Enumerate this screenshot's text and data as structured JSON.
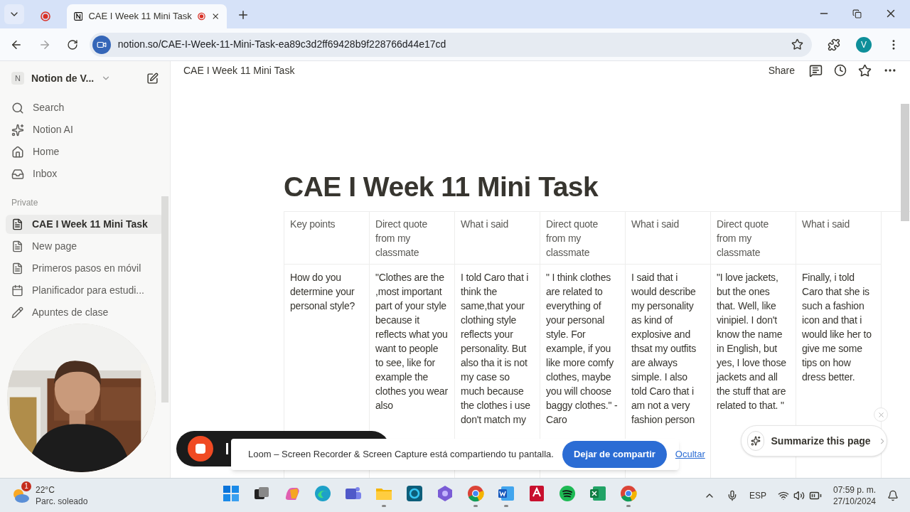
{
  "browser": {
    "tabs": [
      {
        "title": "CAE I Week 11 Mini Task",
        "selected": true
      }
    ],
    "url": "notion.so/CAE-I-Week-11-Mini-Task-ea89c3d2ff69428b9f228766d44e17cd",
    "profile": "V"
  },
  "sidebar": {
    "workspace_icon": "N",
    "workspace": "Notion de V...",
    "nav": [
      {
        "label": "Search"
      },
      {
        "label": "Notion AI"
      },
      {
        "label": "Home"
      },
      {
        "label": "Inbox"
      }
    ],
    "section": "Private",
    "pages": [
      {
        "label": "CAE I Week 11 Mini Task",
        "kind": "doc",
        "selected": true
      },
      {
        "label": "New page",
        "kind": "doc",
        "selected": false
      },
      {
        "label": "Primeros pasos en móvil",
        "kind": "doc",
        "selected": false
      },
      {
        "label": "Planificador para estudi...",
        "kind": "calendar",
        "selected": false
      },
      {
        "label": "Apuntes de clase",
        "kind": "pencil",
        "selected": false
      }
    ]
  },
  "topbar": {
    "breadcrumb": "CAE I Week 11 Mini Task",
    "share": "Share"
  },
  "page": {
    "title": "CAE I Week 11 Mini Task",
    "table": {
      "columns": [
        "Key points",
        "Direct quote from my classmate",
        "What i said",
        "Direct quote from my classmate",
        "What i said",
        "Direct quote from my classmate",
        "What i said"
      ],
      "rows": [
        [
          "How do you determine your personal style?",
          "\"Clothes are the ,most important part of your style because it reflects what you want to people to see, like for example the clothes you wear also",
          "I told Caro that i think the same,that your clothing style reflects your personality. But also tha it is not my case so much because the clothes i use don't match my",
          "\" I think clothes are related to everything of your personal style. For example, if you like more comfy clothes, maybe you will choose baggy clothes.\" - Caro",
          "I  said that i would describe my personality as kind of explosive and thsat my outfits are always simple. I also told Caro that i am not a very fashion person",
          "\"I love jackets, but the ones that. Well, like vinipiel. I don't know the name in English, but yes, I love those jackets and all the stuff that are related to that. \"",
          "Finally, i told Caro that she is such a fashion icon and that i would like her to give me some tips on how dress better."
        ]
      ]
    }
  },
  "summarize": {
    "label": "Summarize this page"
  },
  "loom": {
    "message": "Loom – Screen Recorder & Screen Capture está compartiendo tu pantalla.",
    "stop": "Dejar de compartir",
    "hide": "Ocultar"
  },
  "taskbar": {
    "weather": {
      "temp": "22°C",
      "desc": "Parc. soleado",
      "badge": "1"
    },
    "apps": [
      {
        "running": false
      },
      {
        "running": false
      },
      {
        "running": false
      },
      {
        "running": false
      },
      {
        "running": false
      },
      {
        "running": true
      },
      {
        "running": false
      },
      {
        "running": false
      },
      {
        "running": true
      },
      {
        "running": true
      },
      {
        "running": false
      },
      {
        "running": false
      },
      {
        "running": false
      },
      {
        "running": true
      }
    ],
    "language": "ESP",
    "time": "07:59 p. m.",
    "date": "27/10/2024"
  }
}
